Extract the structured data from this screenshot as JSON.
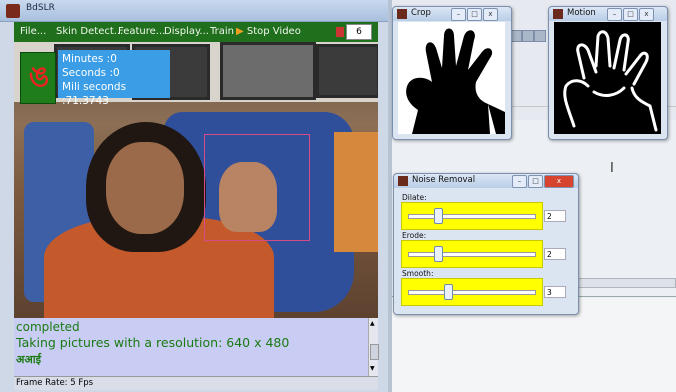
{
  "main_window": {
    "title": "BdSLR",
    "menu": [
      {
        "label": "File..."
      },
      {
        "label": "Skin Detect..."
      },
      {
        "label": "Feature..."
      },
      {
        "label": "Display..."
      },
      {
        "label": "Train"
      },
      {
        "label": "Stop Video",
        "icon": "play-icon"
      }
    ],
    "menu_box_value": "6",
    "timer": {
      "minutes": "Minutes :0",
      "seconds": "Seconds :0",
      "milliseconds": "Mili seconds :71.3743"
    },
    "log": {
      "line1": "completed",
      "line2": "Taking pictures with a resolution: 640 x 480",
      "line3": "अआई"
    },
    "status": "Frame Rate: 5 Fps",
    "colors": {
      "menubar": "#1f6f1c",
      "timer": "#3a9de6",
      "log_bg": "#c9cdf4",
      "log_text": "#1a7a14"
    }
  },
  "crop_window": {
    "title": "Crop"
  },
  "motion_window": {
    "title": "Motion"
  },
  "noise_window": {
    "title": "Noise Removal",
    "controls": [
      {
        "label": "Dilate:",
        "value": "2",
        "level": 0.22
      },
      {
        "label": "Erode:",
        "value": "2",
        "level": 0.22
      },
      {
        "label": "Smooth:",
        "value": "3",
        "level": 0.3
      }
    ],
    "colors": {
      "slider_bg": "#ffff00"
    }
  },
  "window_buttons": {
    "minimize": "–",
    "maximize": "□",
    "close": "x"
  }
}
